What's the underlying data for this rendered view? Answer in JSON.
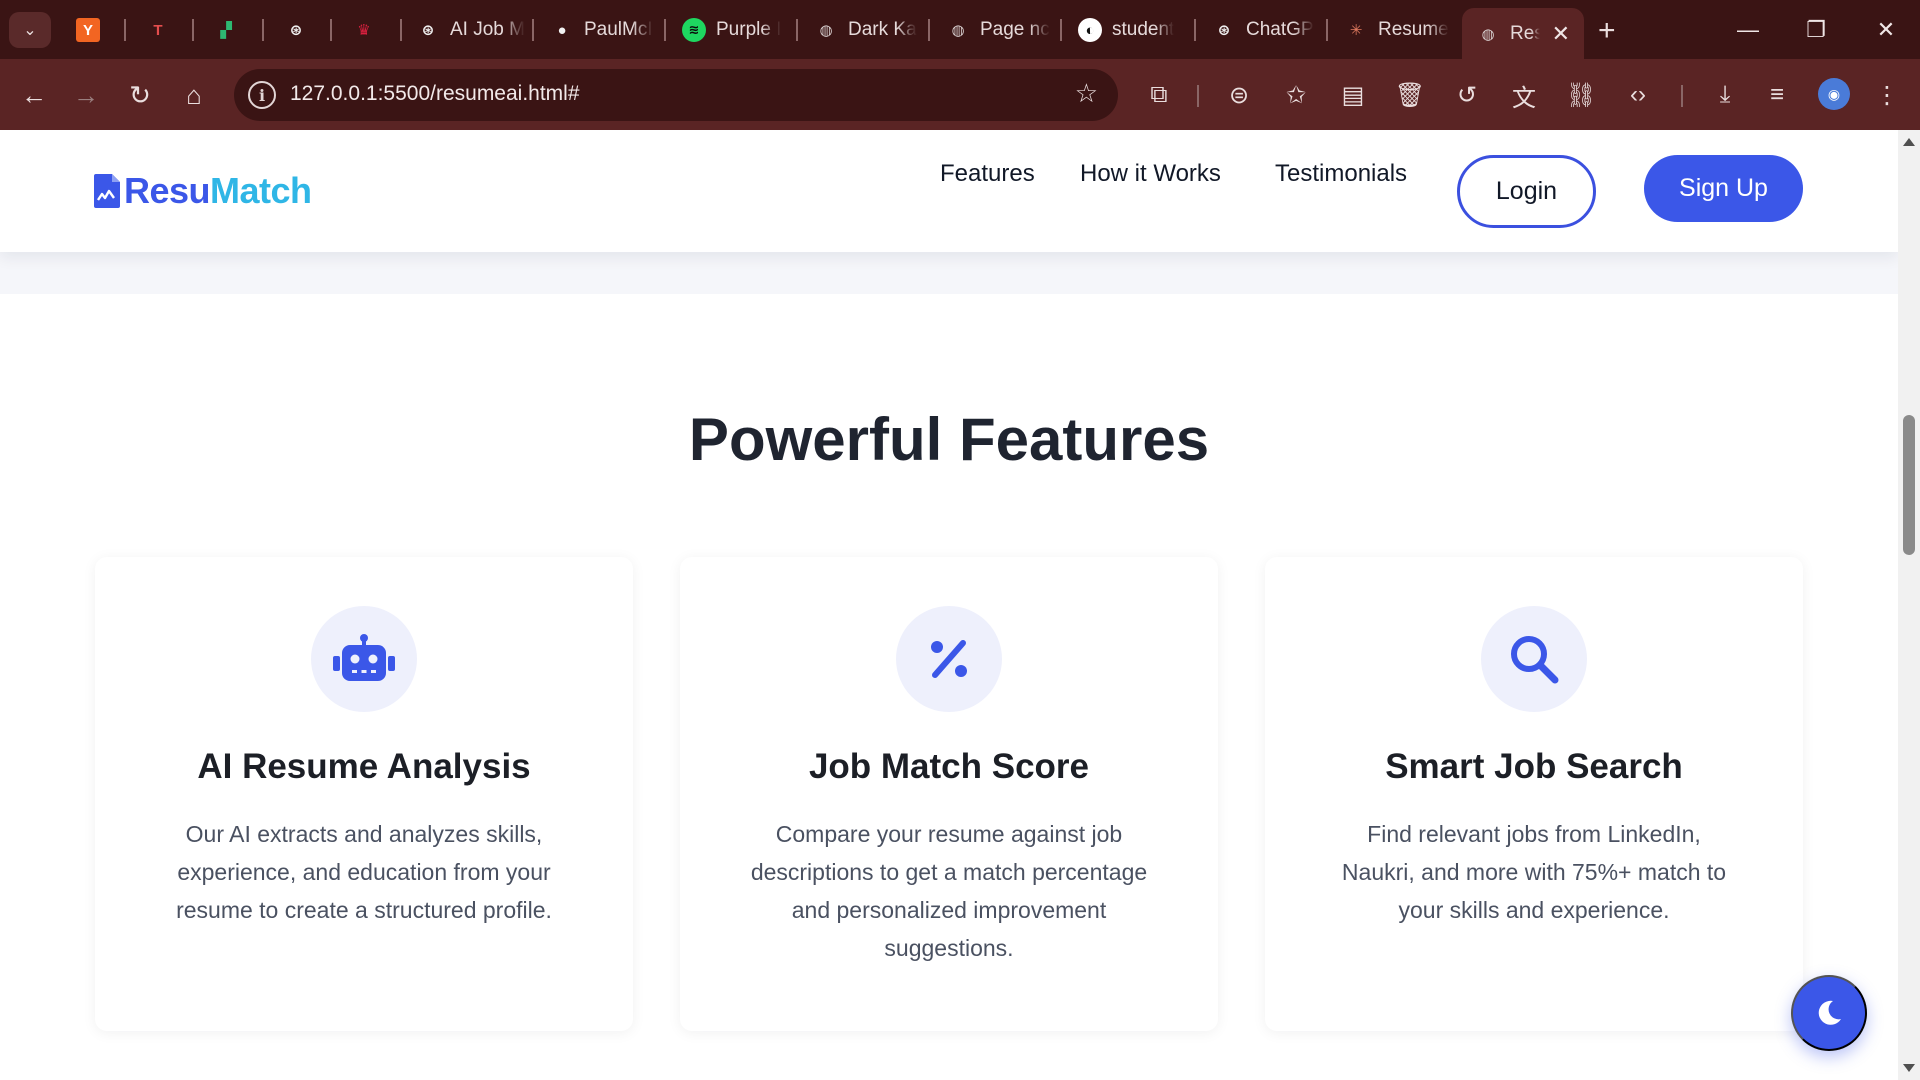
{
  "browser": {
    "tabs": [
      {
        "label": "",
        "icon": "y-combinator-icon",
        "glyph": "Y",
        "bg": "#f26522",
        "fg": "#ffffff"
      },
      {
        "label": "",
        "icon": "tj-icon",
        "glyph": "T",
        "bg": "transparent",
        "fg": "#e44d4d"
      },
      {
        "label": "",
        "icon": "green-app-icon",
        "glyph": "▞",
        "bg": "transparent",
        "fg": "#2eb872"
      },
      {
        "label": "",
        "icon": "openai-icon",
        "glyph": "⊛",
        "bg": "transparent",
        "fg": "#f2f2f2"
      },
      {
        "label": "",
        "icon": "crown-icon",
        "glyph": "♛",
        "bg": "transparent",
        "fg": "#d9203f"
      },
      {
        "label": "AI Job M",
        "icon": "openai-icon",
        "glyph": "⊛",
        "bg": "transparent",
        "fg": "#f2f2f2"
      },
      {
        "label": "PaulMcI",
        "icon": "github-icon",
        "glyph": "●",
        "bg": "transparent",
        "fg": "#f2f2f2"
      },
      {
        "label": "Purple I",
        "icon": "spotify-icon",
        "glyph": "≋",
        "bg": "#1ed760",
        "fg": "#0b0b0b"
      },
      {
        "label": "Dark Ka",
        "icon": "globe-icon",
        "glyph": "◍",
        "bg": "transparent",
        "fg": "#d8cfcf"
      },
      {
        "label": "Page nc",
        "icon": "globe-icon",
        "glyph": "◍",
        "bg": "transparent",
        "fg": "#d8cfcf"
      },
      {
        "label": "student",
        "icon": "student-site-icon",
        "glyph": "◐",
        "bg": "#ffffff",
        "fg": "#111111"
      },
      {
        "label": "ChatGP",
        "icon": "openai-icon",
        "glyph": "⊛",
        "bg": "transparent",
        "fg": "#f2f2f2"
      },
      {
        "label": "Resume",
        "icon": "claude-icon",
        "glyph": "✳",
        "bg": "transparent",
        "fg": "#e07a5f"
      },
      {
        "label": "Res",
        "icon": "globe-icon",
        "glyph": "◍",
        "bg": "transparent",
        "fg": "#d8cfcf"
      }
    ],
    "url": "127.0.0.1:5500/resumeai.html#"
  },
  "header": {
    "logo_part1": "Resu",
    "logo_part2": "Match",
    "nav": [
      "Features",
      "How it Works",
      "Testimonials"
    ],
    "login_label": "Login",
    "signup_label": "Sign Up"
  },
  "features": {
    "title": "Powerful Features",
    "cards": [
      {
        "icon": "robot-icon",
        "title": "AI Resume Analysis",
        "description": "Our AI extracts and analyzes skills, experience, and education from your resume to create a structured profile."
      },
      {
        "icon": "percent-icon",
        "title": "Job Match Score",
        "description": "Compare your resume against job descriptions to get a match percentage and personalized improvement suggestions."
      },
      {
        "icon": "search-icon",
        "title": "Smart Job Search",
        "description": "Find relevant jobs from LinkedIn, Naukri, and more with 75%+ match to your skills and experience."
      }
    ]
  },
  "colors": {
    "brand_blue": "#3b57e8",
    "brand_cyan": "#2fb6e6",
    "chrome_dark": "#3a1414",
    "chrome_toolbar": "#5a2424"
  }
}
